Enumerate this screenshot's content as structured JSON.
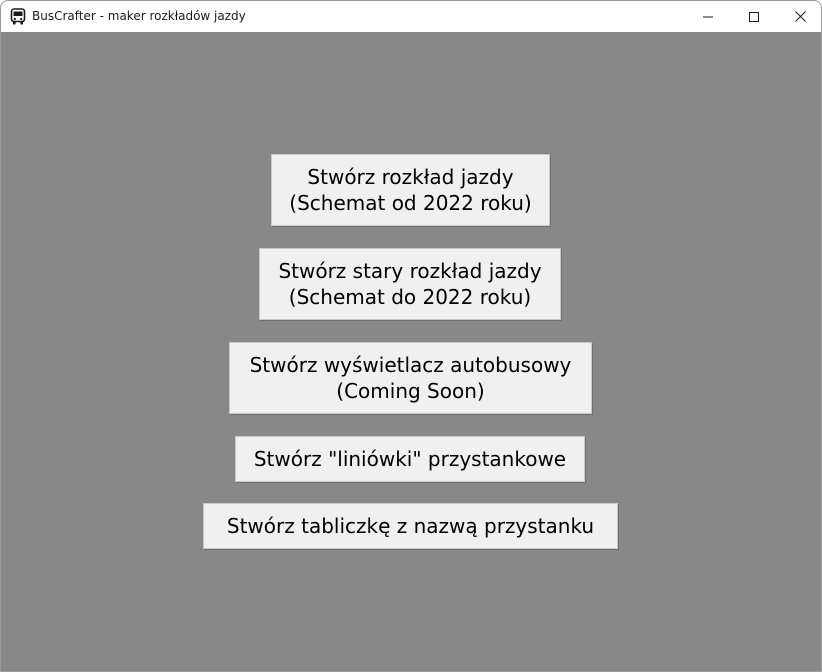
{
  "window": {
    "title": "BusCrafter - maker rozkładów jazdy",
    "app_icon": "bus-icon",
    "controls": {
      "minimize": "minimize-icon",
      "maximize": "maximize-icon",
      "close": "close-icon"
    }
  },
  "menu": {
    "buttons": [
      {
        "line1": "Stwórz rozkład jazdy",
        "line2": "(Schemat od 2022 roku)"
      },
      {
        "line1": "Stwórz stary rozkład jazdy",
        "line2": "(Schemat do 2022 roku)"
      },
      {
        "line1": "Stwórz wyświetlacz autobusowy",
        "line2": "(Coming Soon)"
      },
      {
        "line1": "Stwórz \"liniówki\" przystankowe"
      },
      {
        "line1": "Stwórz tabliczkę z nazwą przystanku"
      }
    ]
  },
  "colors": {
    "background": "#888888",
    "button": "#f0f0f0",
    "titlebar": "#ffffff"
  }
}
